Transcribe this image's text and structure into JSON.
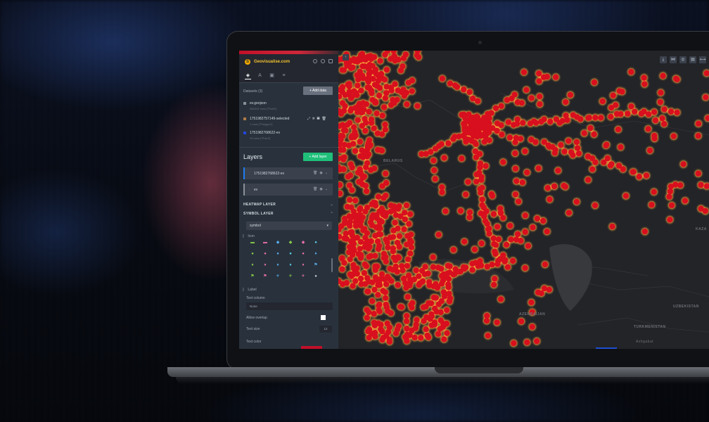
{
  "app": {
    "brand": "Geovisualise.com"
  },
  "tabs": [
    "layer-tab",
    "filter-tab",
    "interaction-tab",
    "basemap-tab"
  ],
  "datasets": {
    "header": "Datasets (3)",
    "add_button": "+ Add data",
    "items": [
      {
        "name": "ev.geojson",
        "meta": "385319 rows [\"Point\"]",
        "color": "#8a8f96"
      },
      {
        "name": "1751982757149-selected",
        "meta": "1 rows [\"Polygon\"]",
        "color": "#b07a46"
      },
      {
        "name": "1751982768622-ev",
        "meta": "23 rows [\"Point\"]",
        "color": "#2446e0"
      }
    ]
  },
  "layers": {
    "title": "Layers",
    "add_button": "+ Add layer",
    "items": [
      {
        "name": "1751982768622-ev"
      },
      {
        "name": "ev"
      }
    ]
  },
  "accordions": {
    "heatmap": "HEATMAP LAYER",
    "symbol": "SYMBOL LAYER"
  },
  "symbol": {
    "selected": "symbol",
    "icon_header": "Icon",
    "label_header": "Label",
    "text_column_label": "Text column",
    "text_column_value": "None",
    "allow_overlap_label": "Allow overlap",
    "text_size_label": "Text size",
    "text_size_value": "12",
    "text_color_label": "Text color"
  },
  "map": {
    "countries": [
      "BELARUS",
      "UZBEKISTAN",
      "TURKMENISTAN",
      "AZERBAIJAN",
      "KAZA"
    ],
    "cities": [
      "Ashgabat"
    ],
    "point_color": "#d80f1e",
    "glow_color": "#f7a23a"
  },
  "colors": {
    "sidebar_bg": "#29323c",
    "accent_green": "#1fbf7a",
    "brand_yellow": "#f2c230"
  }
}
